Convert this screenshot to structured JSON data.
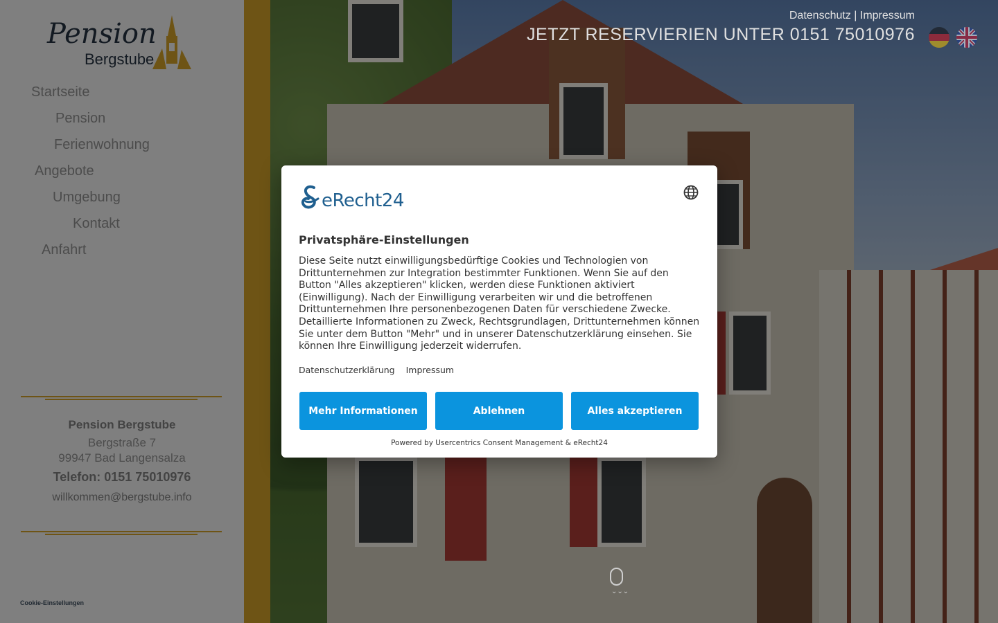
{
  "header": {
    "links": [
      "Datenschutz",
      "Impressum"
    ],
    "link_separator": "|",
    "reservation_text": "JETZT RESERVIERIEN UNTER 0151 75010976",
    "languages": [
      {
        "code": "de",
        "icon": "german-flag-icon"
      },
      {
        "code": "en",
        "icon": "uk-flag-icon"
      }
    ]
  },
  "logo": {
    "script": "Pension",
    "subtitle": "Bergstube",
    "icon": "church-tower-icon"
  },
  "nav": {
    "items": [
      {
        "label": "Startseite"
      },
      {
        "label": "Pension"
      },
      {
        "label": "Ferienwohnung"
      },
      {
        "label": "Angebote"
      },
      {
        "label": "Umgebung"
      },
      {
        "label": "Kontakt"
      },
      {
        "label": "Anfahrt"
      }
    ]
  },
  "contact": {
    "name": "Pension Bergstube",
    "street": "Bergstraße 7",
    "city": "99947 Bad Langensalza",
    "phone": "Telefon: 0151 75010976",
    "email": "willkommen@bergstube.info"
  },
  "footer": {
    "cookie_settings": "Cookie-Einstellungen"
  },
  "scroll_hint": {
    "icon": "mouse-scroll-icon",
    "arrows": "⌄⌄⌄"
  },
  "consent": {
    "brand": "eRecht24",
    "brand_icon": "erecht24-logo-icon",
    "language_icon": "globe-icon",
    "title": "Privatsphäre-Einstellungen",
    "body": "Diese Seite nutzt einwilligungsbedürftige Cookies und Technologien von Drittunternehmen zur Integration bestimmter Funktionen. Wenn Sie auf den Button \"Alles akzeptieren\" klicken, werden diese Funktionen aktiviert (Einwilligung). Nach der Einwilligung verarbeiten wir und die betroffenen Drittunternehmen Ihre personenbezogenen Daten für verschiedene Zwecke. Detaillierte Informationen zu Zweck, Rechtsgrundlagen, Drittunternehmen können Sie unter dem Button \"Mehr\" und in unserer Datenschutzerklärung einsehen. Sie können Ihre Einwilligung jederzeit widerrufen.",
    "links": {
      "privacy": "Datenschutzerklärung",
      "imprint": "Impressum"
    },
    "buttons": {
      "more": "Mehr Informationen",
      "deny": "Ablehnen",
      "accept_all": "Alles akzeptieren"
    },
    "powered_by": "Powered by Usercentrics Consent Management & eRecht24",
    "accent_color": "#0b94de"
  },
  "colors": {
    "gold": "#c99a27",
    "sidebar_bg": "#e8e8e8",
    "nav_text": "#8a8a8a"
  }
}
